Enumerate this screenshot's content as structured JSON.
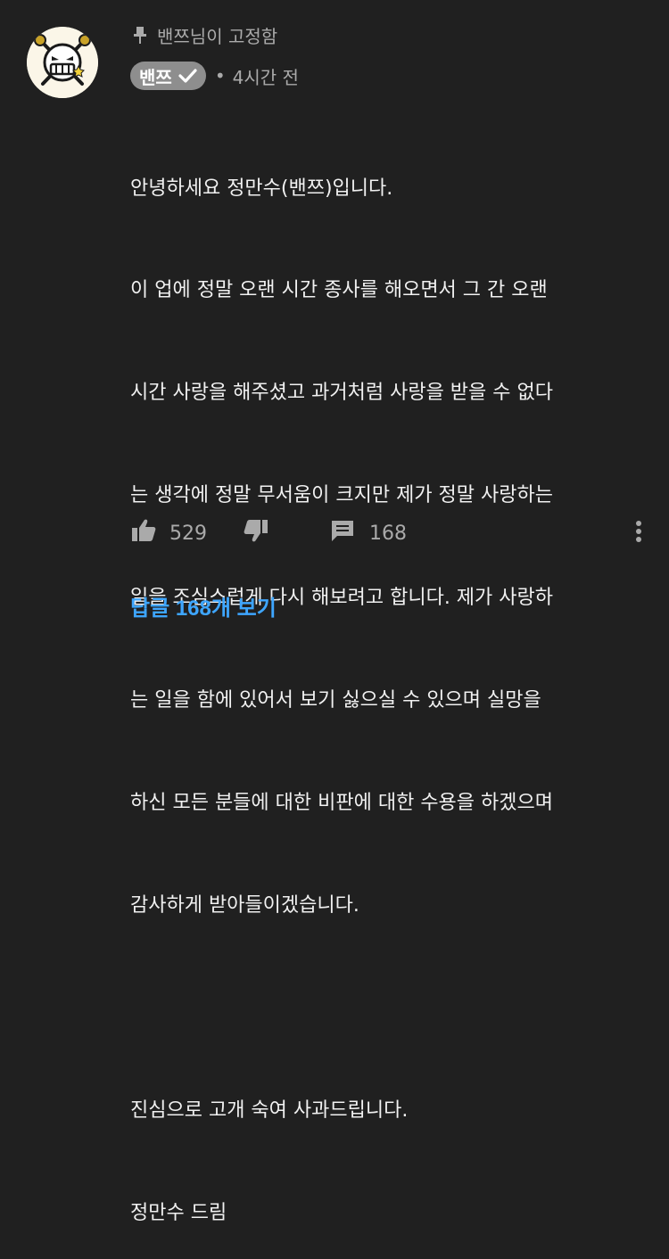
{
  "comment": {
    "pinned_label": "밴쯔님이 고정함",
    "author": "밴쯔",
    "timestamp": "4시간 전",
    "lines": [
      "안녕하세요 정만수(밴쯔)입니다.",
      "이 업에 정말 오랜 시간 종사를 해오면서 그 간 오랜",
      "시간 사랑을 해주셨고 과거처럼 사랑을 받을 수 없다",
      "는 생각에 정말 무서움이 크지만 제가 정말 사랑하는",
      "일을 조심스럽게 다시 해보려고 합니다. 제가 사랑하",
      "는 일을 함에 있어서 보기 싫으실 수 있으며 실망을",
      "하신 모든 분들에 대한 비판에 대한 수용을 하겠으며",
      "감사하게 받아들이겠습니다.",
      "",
      "진심으로 고개 숙여 사과드립니다.",
      "정만수 드림"
    ],
    "likes": "529",
    "reply_count": "168",
    "view_replies_label": "답글 168개 보기"
  },
  "colors": {
    "background": "#202020",
    "text": "#f1f1f1",
    "muted": "#aaaaaa",
    "badge": "#8e8e8e",
    "link": "#3ea6ff"
  },
  "icons": {
    "pin": "pin-icon",
    "verified": "check-icon",
    "like": "thumbs-up-icon",
    "dislike": "thumbs-down-icon",
    "reply": "comment-icon",
    "more": "more-vert-icon"
  }
}
